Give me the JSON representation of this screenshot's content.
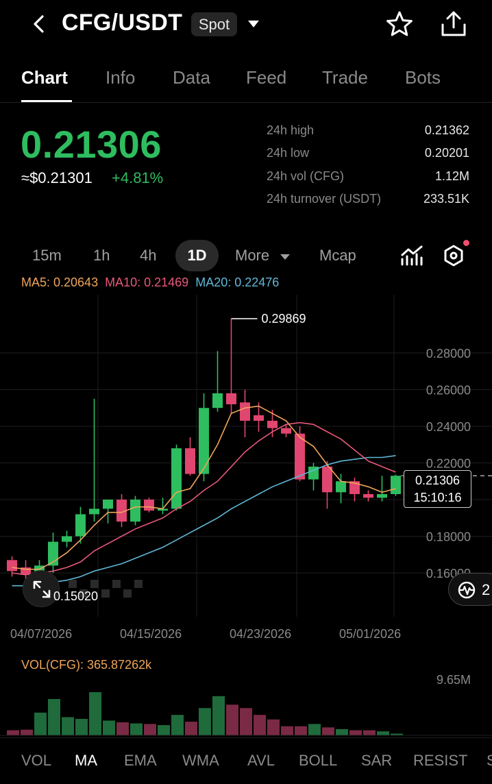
{
  "header": {
    "pair": "CFG/USDT",
    "market_badge": "Spot"
  },
  "tabs": [
    "Chart",
    "Info",
    "Data",
    "Feed",
    "Trade",
    "Bots"
  ],
  "ticker": {
    "price": "0.21306",
    "usd_price": "≈$0.21301",
    "change": "+4.81%"
  },
  "stats": [
    {
      "label": "24h high",
      "value": "0.21362"
    },
    {
      "label": "24h low",
      "value": "0.20201"
    },
    {
      "label": "24h vol (CFG)",
      "value": "1.12M"
    },
    {
      "label": "24h turnover (USDT)",
      "value": "233.51K"
    }
  ],
  "intervals": {
    "m15": "15m",
    "h1": "1h",
    "h4": "4h",
    "d1": "1D",
    "more": "More",
    "mcap": "Mcap"
  },
  "ma": {
    "ma5": "MA5: 0.20643",
    "ma10": "MA10: 0.21469",
    "ma20": "MA20: 0.22476"
  },
  "chart": {
    "current_price": "0.21306",
    "countdown": "15:10:16",
    "high_label": "0.29869",
    "low_label": "0.15020",
    "side_pill": "2",
    "volume_label": "VOL(CFG): 365.87262k",
    "volume_max": "9.65M",
    "dates": [
      "04/07/2026",
      "04/15/2026",
      "04/23/2026",
      "05/01/2026"
    ]
  },
  "indicators": [
    "VOL",
    "MA",
    "EMA",
    "WMA",
    "AVL",
    "BOLL",
    "SAR",
    "RESIST",
    "S"
  ],
  "colors": {
    "up": "#2ebd5f",
    "down": "#e0466f",
    "ma5": "#f0a55a",
    "ma10": "#e8587a",
    "ma20": "#5fb8d8"
  },
  "chart_data": {
    "type": "candlestick",
    "y_ticks": [
      "0.28000",
      "0.26000",
      "0.24000",
      "0.22000",
      "0.18000",
      "0.16000"
    ],
    "ylim": [
      0.148,
      0.305
    ],
    "candles": [
      {
        "o": 0.167,
        "h": 0.169,
        "l": 0.158,
        "c": 0.161
      },
      {
        "o": 0.163,
        "h": 0.167,
        "l": 0.156,
        "c": 0.159
      },
      {
        "o": 0.158,
        "h": 0.167,
        "l": 0.155,
        "c": 0.164
      },
      {
        "o": 0.164,
        "h": 0.182,
        "l": 0.16,
        "c": 0.177
      },
      {
        "o": 0.177,
        "h": 0.183,
        "l": 0.174,
        "c": 0.18
      },
      {
        "o": 0.18,
        "h": 0.196,
        "l": 0.176,
        "c": 0.192
      },
      {
        "o": 0.192,
        "h": 0.255,
        "l": 0.188,
        "c": 0.195
      },
      {
        "o": 0.195,
        "h": 0.2,
        "l": 0.187,
        "c": 0.2
      },
      {
        "o": 0.2,
        "h": 0.203,
        "l": 0.185,
        "c": 0.188
      },
      {
        "o": 0.188,
        "h": 0.202,
        "l": 0.186,
        "c": 0.2
      },
      {
        "o": 0.2,
        "h": 0.201,
        "l": 0.193,
        "c": 0.194
      },
      {
        "o": 0.194,
        "h": 0.201,
        "l": 0.192,
        "c": 0.195
      },
      {
        "o": 0.195,
        "h": 0.23,
        "l": 0.194,
        "c": 0.228
      },
      {
        "o": 0.228,
        "h": 0.234,
        "l": 0.213,
        "c": 0.214
      },
      {
        "o": 0.214,
        "h": 0.258,
        "l": 0.21,
        "c": 0.25
      },
      {
        "o": 0.25,
        "h": 0.281,
        "l": 0.248,
        "c": 0.258
      },
      {
        "o": 0.258,
        "h": 0.2987,
        "l": 0.247,
        "c": 0.252
      },
      {
        "o": 0.253,
        "h": 0.26,
        "l": 0.234,
        "c": 0.243
      },
      {
        "o": 0.246,
        "h": 0.253,
        "l": 0.237,
        "c": 0.243
      },
      {
        "o": 0.243,
        "h": 0.249,
        "l": 0.234,
        "c": 0.239
      },
      {
        "o": 0.239,
        "h": 0.241,
        "l": 0.234,
        "c": 0.236
      },
      {
        "o": 0.236,
        "h": 0.24,
        "l": 0.21,
        "c": 0.211
      },
      {
        "o": 0.211,
        "h": 0.22,
        "l": 0.205,
        "c": 0.218
      },
      {
        "o": 0.218,
        "h": 0.221,
        "l": 0.195,
        "c": 0.204
      },
      {
        "o": 0.204,
        "h": 0.214,
        "l": 0.198,
        "c": 0.21
      },
      {
        "o": 0.21,
        "h": 0.212,
        "l": 0.199,
        "c": 0.203
      },
      {
        "o": 0.203,
        "h": 0.205,
        "l": 0.199,
        "c": 0.201
      },
      {
        "o": 0.201,
        "h": 0.213,
        "l": 0.199,
        "c": 0.203
      },
      {
        "o": 0.203,
        "h": 0.2136,
        "l": 0.202,
        "c": 0.213
      }
    ],
    "ma5": [
      0.163,
      0.162,
      0.162,
      0.166,
      0.171,
      0.178,
      0.186,
      0.193,
      0.193,
      0.196,
      0.196,
      0.195,
      0.204,
      0.206,
      0.217,
      0.23,
      0.247,
      0.25,
      0.251,
      0.247,
      0.243,
      0.234,
      0.229,
      0.219,
      0.21,
      0.209,
      0.207,
      0.204,
      0.206
    ],
    "ma10": [
      0.16,
      0.159,
      0.16,
      0.161,
      0.163,
      0.166,
      0.172,
      0.176,
      0.18,
      0.184,
      0.187,
      0.19,
      0.195,
      0.199,
      0.205,
      0.21,
      0.218,
      0.226,
      0.232,
      0.237,
      0.241,
      0.242,
      0.241,
      0.237,
      0.233,
      0.227,
      0.221,
      0.218,
      0.215
    ],
    "ma20": [
      0.153,
      0.153,
      0.154,
      0.155,
      0.156,
      0.158,
      0.161,
      0.163,
      0.165,
      0.168,
      0.171,
      0.174,
      0.178,
      0.182,
      0.186,
      0.19,
      0.195,
      0.199,
      0.203,
      0.207,
      0.21,
      0.213,
      0.216,
      0.219,
      0.221,
      0.222,
      0.223,
      0.223,
      0.224
    ],
    "volume": [
      0.9,
      1.0,
      4.0,
      6.4,
      3.2,
      2.9,
      7.6,
      2.6,
      2.3,
      2.1,
      2.0,
      1.8,
      3.6,
      2.4,
      4.8,
      6.9,
      5.4,
      4.8,
      3.6,
      2.8,
      1.6,
      1.6,
      2.0,
      1.4,
      1.1,
      0.9,
      0.9,
      0.7,
      0.3
    ],
    "volume_unit": "M"
  }
}
